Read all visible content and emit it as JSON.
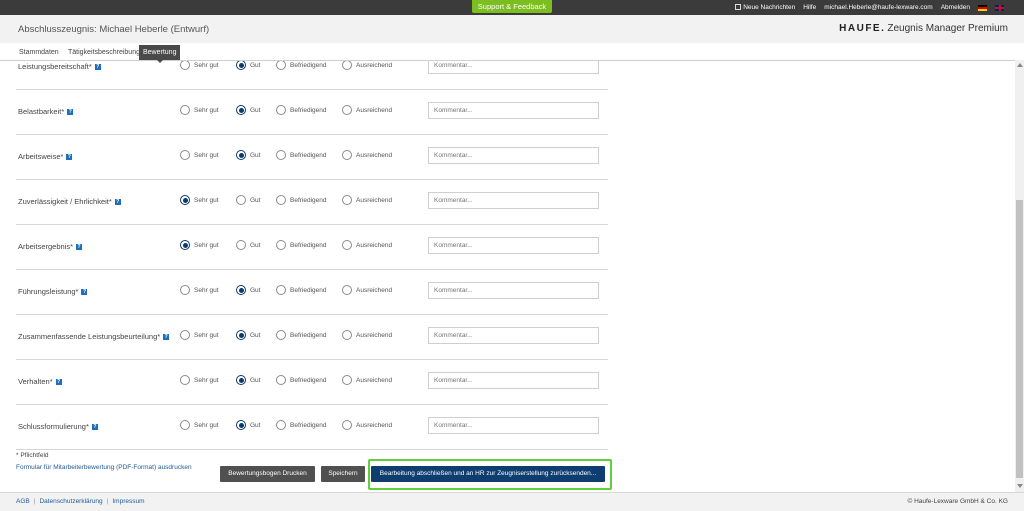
{
  "topbar": {
    "support_label": "Support & Feedback",
    "news_label": "Neue Nachrichten",
    "help_label": "Hilfe",
    "user_email": "michael.Heberle@haufe-lexware.com",
    "logout_label": "Abmelden"
  },
  "header": {
    "doc_title": "Abschlusszeugnis: Michael Heberle (Entwurf)",
    "brand_logo": "HAUFE.",
    "brand_product": "Zeugnis Manager Premium"
  },
  "tabs": [
    {
      "label": "Stammdaten"
    },
    {
      "label": "Tätigkeitsbeschreibung"
    },
    {
      "label": "Bewertung"
    }
  ],
  "options": [
    "Sehr gut",
    "Gut",
    "Befriedigend",
    "Ausreichend"
  ],
  "comment_placeholder": "Kommentar...",
  "rows": [
    {
      "label": "Leistungsbereitschaft*",
      "selected": 1
    },
    {
      "label": "Belastbarkeit*",
      "selected": 1
    },
    {
      "label": "Arbeitsweise*",
      "selected": 1
    },
    {
      "label": "Zuverlässigkeit / Ehrlichkeit*",
      "selected": 0
    },
    {
      "label": "Arbeitsergebnis*",
      "selected": 0
    },
    {
      "label": "Führungsleistung*",
      "selected": 1
    },
    {
      "label": "Zusammenfassende Leistungsbeurteilung*",
      "selected": 1
    },
    {
      "label": "Verhalten*",
      "selected": 1
    },
    {
      "label": "Schlussformulierung*",
      "selected": 1
    }
  ],
  "help_glyph": "?",
  "form_footer": {
    "required_note": "* Pflichtfeld",
    "pdf_link": "Formular für Mitarbeiterbewertung (PDF-Format) ausdrucken",
    "print_button": "Bewertungsbogen Drucken",
    "save_button": "Speichern",
    "submit_button": "Bearbeitung abschließen und an HR zur Zeugniserstellung zurücksenden..."
  },
  "footer": {
    "links": [
      "AGB",
      "Datenschutzerklärung",
      "Impressum"
    ],
    "copyright": "© Haufe-Lexware GmbH & Co. KG"
  }
}
